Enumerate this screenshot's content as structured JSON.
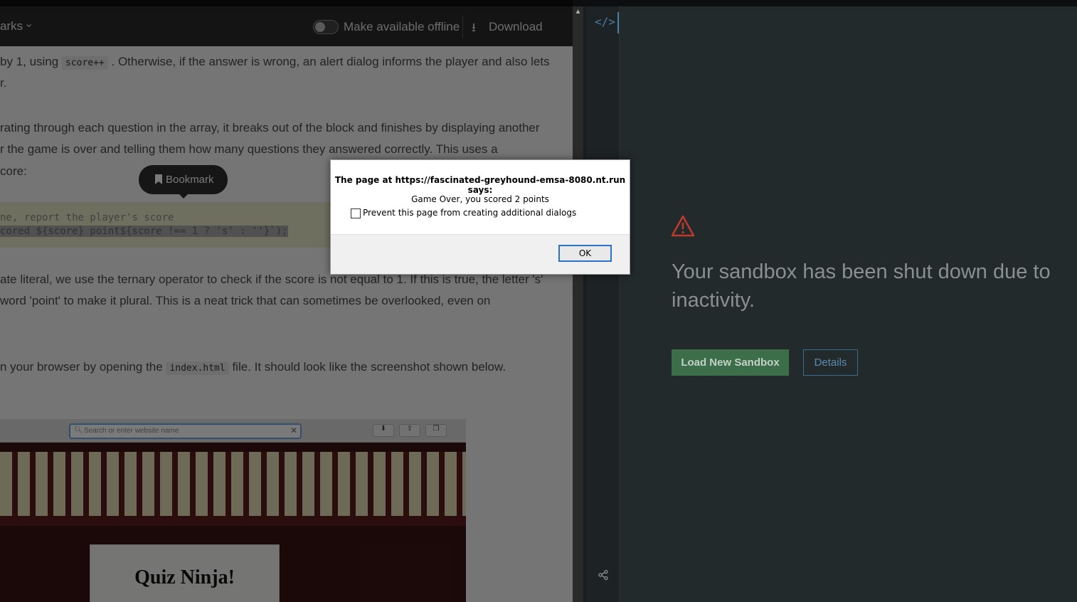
{
  "reader": {
    "header": {
      "bookmarks_label": "arks",
      "offline_label": "Make available offline",
      "download_label": "Download"
    },
    "p1_prefix": "by 1, using",
    "p1_code": "score++",
    "p1_suffix": ". Otherwise, if the answer is wrong, an alert dialog informs the player and also lets",
    "p1_line2": "r.",
    "p2_line1": "rating through each question in the array, it breaks out of the block and finishes by displaying another",
    "p2_line2": "r the game is over and telling them how many questions they answered correctly. This uses a",
    "p2_line3": "core:",
    "code_line1": "ne, report the player's score",
    "code_line2": "cored ${score} point${score !== 1 ? 's' : ''}`);",
    "tooltip_label": "Bookmark",
    "p3_line1": "ate literal, we use the ternary operator to check if the score is not equal to 1. If this is true, the letter 's'",
    "p3_line2": "word 'point' to make it plural. This is a neat trick that can sometimes be overlooked, even on",
    "p4_prefix": "n your browser by opening the",
    "p4_code": "index.html",
    "p4_suffix": "file. It should look like the screenshot shown below.",
    "screenshot": {
      "search_placeholder": "Search or enter website name",
      "title": "Quiz Ninja!"
    }
  },
  "icons": {
    "code": "code-icon",
    "share": "share-icon",
    "warning": "warning-icon",
    "download": "download-icon",
    "bookmark": "bookmark-icon"
  },
  "sandbox": {
    "message": "Your sandbox has been shut down due to inactivity.",
    "load_button": "Load New Sandbox",
    "details_button": "Details",
    "warning_color": "#c0392b"
  },
  "dialog": {
    "heading": "The page at https://fascinated-greyhound-emsa-8080.nt.run says:",
    "message": "Game Over, you scored 2 points",
    "checkbox_label": "Prevent this page from creating additional dialogs",
    "ok_label": "OK"
  }
}
